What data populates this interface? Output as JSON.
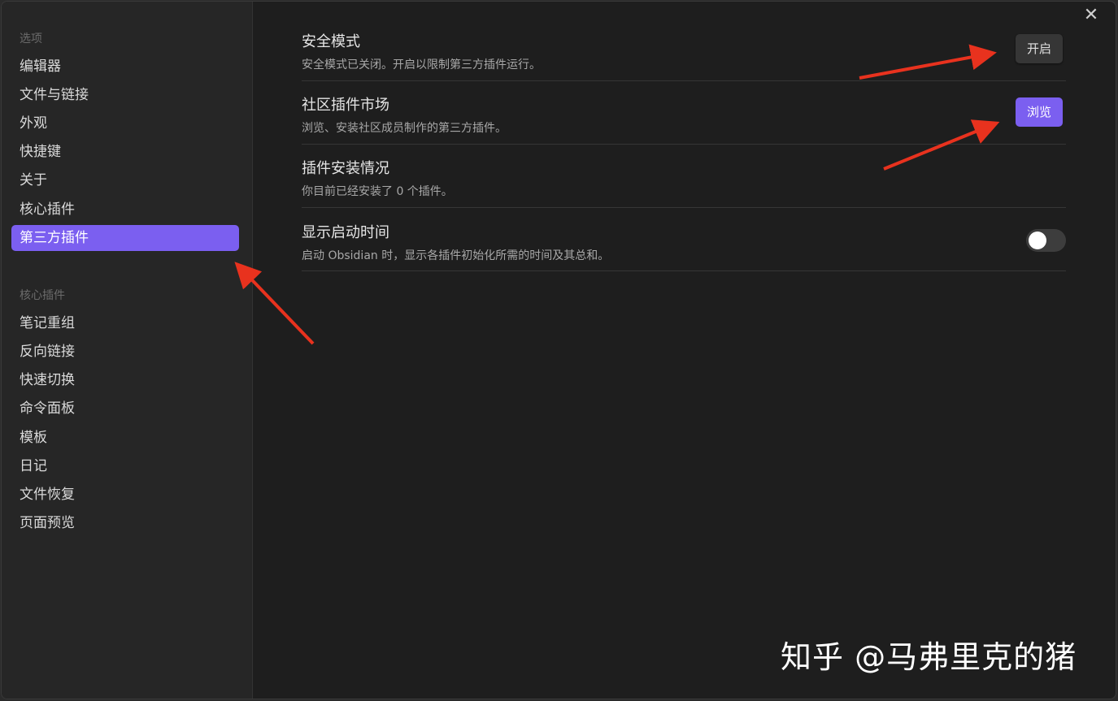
{
  "sidebar": {
    "options_title": "选项",
    "options_items": [
      "编辑器",
      "文件与链接",
      "外观",
      "快捷键",
      "关于",
      "核心插件",
      "第三方插件"
    ],
    "active_item": "第三方插件",
    "core_plugins_title": "核心插件",
    "core_plugin_items": [
      "笔记重组",
      "反向链接",
      "快速切换",
      "命令面板",
      "模板",
      "日记",
      "文件恢复",
      "页面预览"
    ]
  },
  "close_glyph": "✕",
  "settings": {
    "safe_mode": {
      "name": "安全模式",
      "desc": "安全模式已关闭。开启以限制第三方插件运行。",
      "button": "开启"
    },
    "community": {
      "name": "社区插件市场",
      "desc": "浏览、安装社区成员制作的第三方插件。",
      "button": "浏览"
    },
    "installed": {
      "name": "插件安装情况",
      "desc": "你目前已经安装了 0 个插件。"
    },
    "startup_time": {
      "name": "显示启动时间",
      "desc": "启动 Obsidian 时，显示各插件初始化所需的时间及其总和。",
      "enabled": false
    }
  },
  "watermark": "知乎 @马弗里克的猪",
  "colors": {
    "accent": "#7b5ff0",
    "arrow": "#e8321e",
    "background": "#1e1e1e",
    "sidebar": "#262626"
  }
}
